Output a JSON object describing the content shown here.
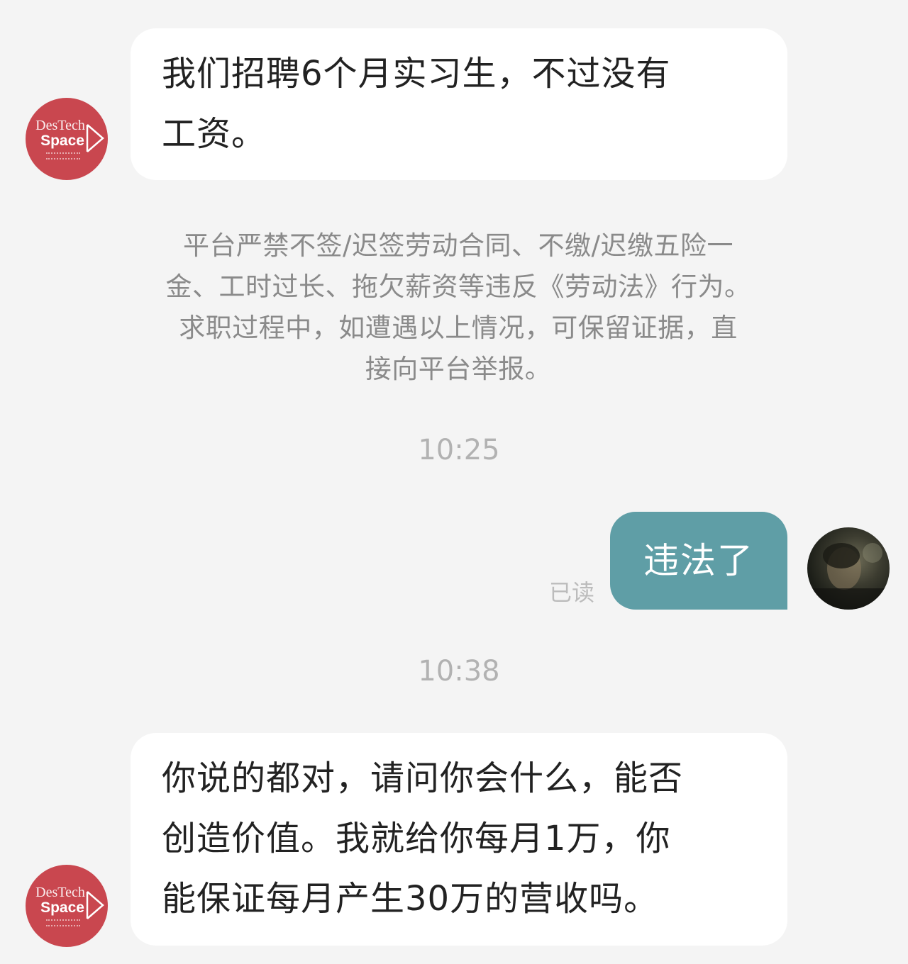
{
  "company": {
    "avatar_logo_top": "DesTech",
    "avatar_logo_main": "Space"
  },
  "messages": {
    "incoming_1": {
      "lines": [
        "我们招聘6个月实习生，不过没有",
        "工资。"
      ]
    },
    "system_notice": {
      "lines": [
        "平台严禁不签/迟签劳动合同、不缴/迟缴五险一",
        "金、工时过长、拖欠薪资等违反《劳动法》行为。",
        "求职过程中，如遭遇以上情况，可保留证据，直",
        "接向平台举报。"
      ]
    },
    "timestamp_1": "10:25",
    "outgoing_1": {
      "text": "违法了",
      "status": "已读"
    },
    "timestamp_2": "10:38",
    "incoming_2": {
      "lines": [
        "你说的都对，请问你会什么，能否",
        "创造价值。我就给你每月1万，你",
        "能保证每月产生30万的营收吗。"
      ]
    }
  }
}
